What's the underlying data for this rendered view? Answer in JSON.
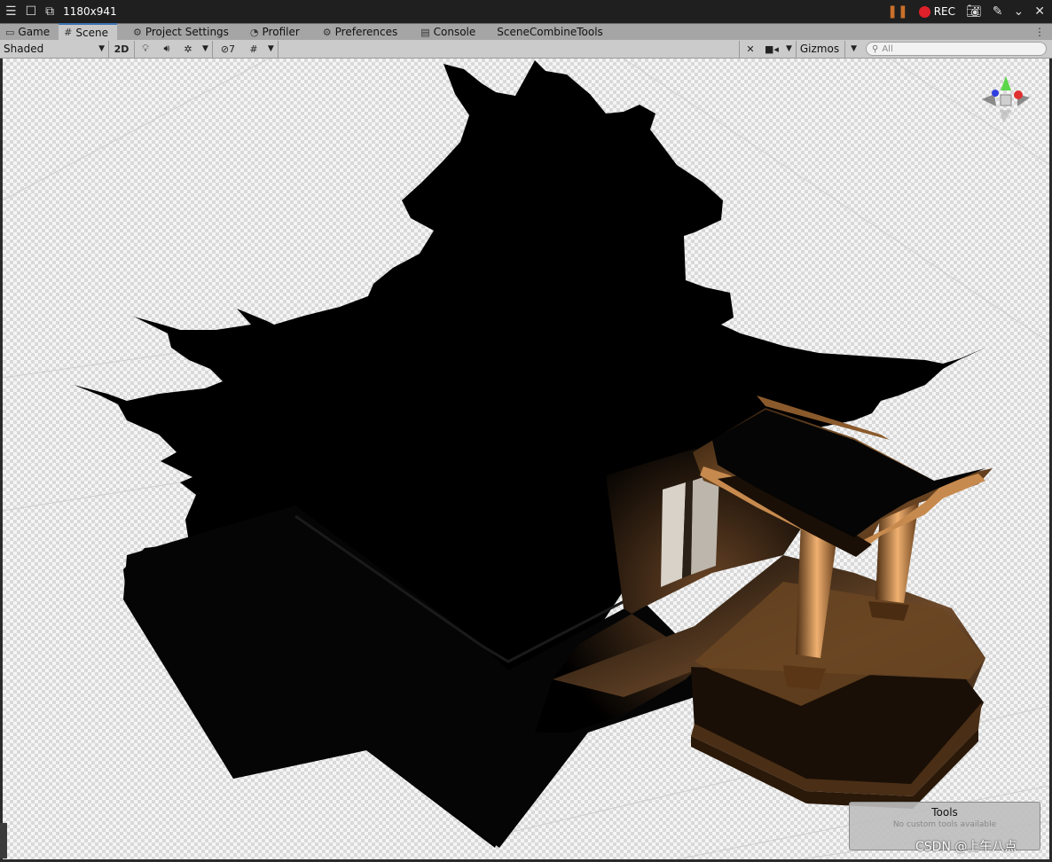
{
  "capture": {
    "title": "1180x941",
    "rec_label": "REC"
  },
  "tabs": [
    {
      "label": "Game",
      "icon": "gamepad-icon"
    },
    {
      "label": "Scene",
      "icon": "grid-icon"
    },
    {
      "label": "Project Settings",
      "icon": "gear-icon"
    },
    {
      "label": "Profiler",
      "icon": "profiler-icon"
    },
    {
      "label": "Preferences",
      "icon": "gear-icon"
    },
    {
      "label": "Console",
      "icon": "console-icon"
    },
    {
      "label": "SceneCombineTools",
      "icon": ""
    }
  ],
  "toolbar": {
    "draw_mode": "Shaded",
    "mode_2d": "2D",
    "hidden_count": "7",
    "gizmos_label": "Gizmos",
    "search_placeholder": "All"
  },
  "tools_overlay": {
    "title": "Tools",
    "subtitle": "No custom tools available"
  },
  "watermark": "CSDN @上午八点"
}
